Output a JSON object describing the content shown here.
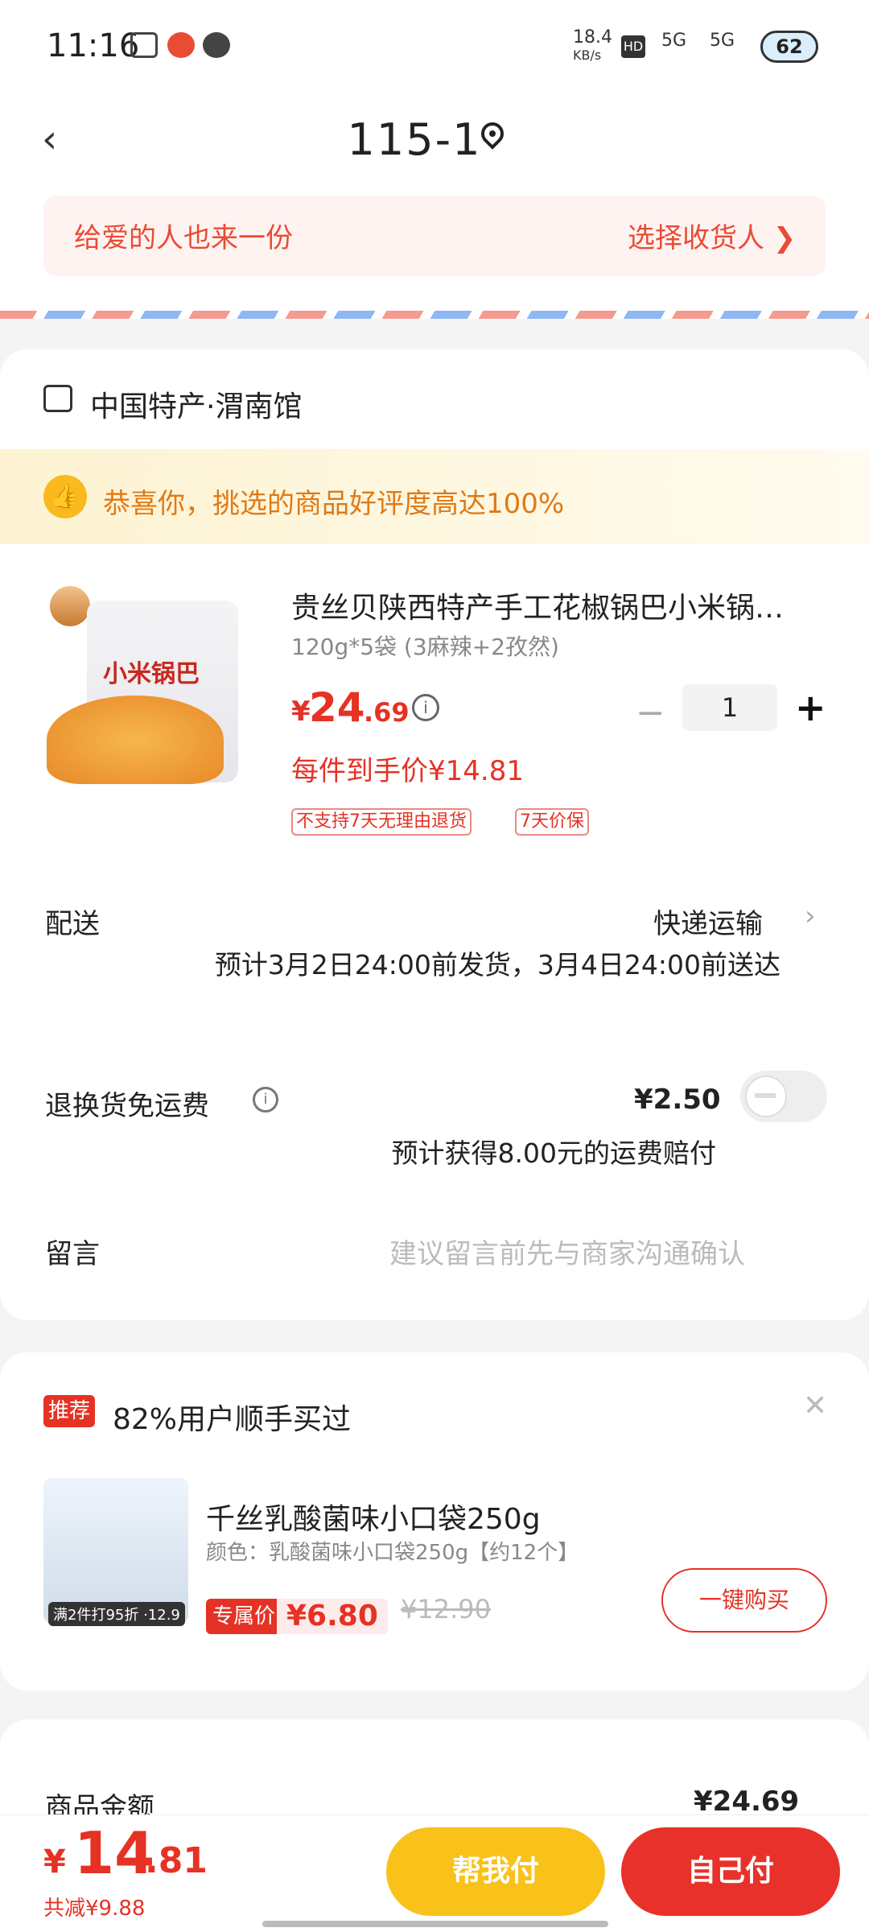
{
  "status_bar": {
    "time": "11:16",
    "net_speed": "18.4",
    "net_unit": "KB/s",
    "sig1": "5G",
    "sig2": "5G",
    "battery": "62"
  },
  "header": {
    "title": "115-1"
  },
  "gift": {
    "left_text": "给爱的人也来一份",
    "right_text": "选择收货人 ❯"
  },
  "store": {
    "name": "中国特产·渭南馆"
  },
  "praise": {
    "text": "恭喜你，挑选的商品好评度高达100%"
  },
  "product": {
    "bag_title": "小米锅巴",
    "title": "贵丝贝陕西特产手工花椒锅巴小米锅…",
    "spec": "120g*5袋 (3麻辣+2孜然)",
    "price_symbol": "¥",
    "price_int": "24",
    "price_dec": ".69",
    "quantity": "1",
    "unit_price": "每件到手价¥14.81",
    "tags": [
      "不支持7天无理由退货",
      "7天价保"
    ]
  },
  "delivery": {
    "label": "配送",
    "method": "快递运输",
    "estimate": "预计3月2日24:00前发货，3月4日24:00前送达"
  },
  "return_shipping": {
    "label": "退换货免运费",
    "fee": "¥2.50",
    "compensation": "预计获得8.00元的运费赔付"
  },
  "message": {
    "label": "留言",
    "placeholder": "建议留言前先与商家沟通确认"
  },
  "recommend": {
    "badge": "推荐",
    "title": "82%用户顺手买过",
    "item_name": "千丝乳酸菌味小口袋250g",
    "item_variant": "颜色：乳酸菌味小口袋250g【约12个】",
    "img_label": "满2件打95折 ·12.9",
    "exclusive_label": "专属价",
    "exclusive_price": "¥6.80",
    "original_price": "¥12.90",
    "buy_label": "一键购买"
  },
  "amount": {
    "label": "商品金额",
    "value": "¥24.69"
  },
  "bottom": {
    "total_symbol": "¥",
    "total_int": "14",
    "total_dec": ".81",
    "saved": "共减¥9.88",
    "pay_friend": "帮我付",
    "pay_self": "自己付"
  }
}
